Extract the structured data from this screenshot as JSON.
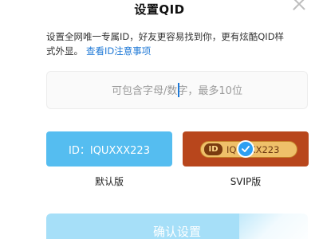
{
  "dialog": {
    "title": "设置QID",
    "close_icon": "close-icon"
  },
  "description": {
    "text": "设置全网唯一专属ID，好友更容易找到你，更有炫酷QID样式外显。",
    "link": "查看ID注意事项"
  },
  "id_input": {
    "value": "",
    "placeholder": "可包含字母/数字，最多10位"
  },
  "styles": [
    {
      "card_text": "ID：IQUXXX223",
      "label": "默认版",
      "selected": false
    },
    {
      "badge": "ID",
      "card_text": "IQUXXX223",
      "label": "SVIP版",
      "selected": true
    }
  ],
  "confirm_button": {
    "label": "确认设置",
    "enabled": false
  },
  "colors": {
    "accent": "#2e9ff2",
    "default_card": "#55bdf0",
    "svip_card": "#b8461c",
    "svip_pill": "#efc06a",
    "link": "#1e78d6",
    "confirm_disabled": "#a6dff8"
  }
}
